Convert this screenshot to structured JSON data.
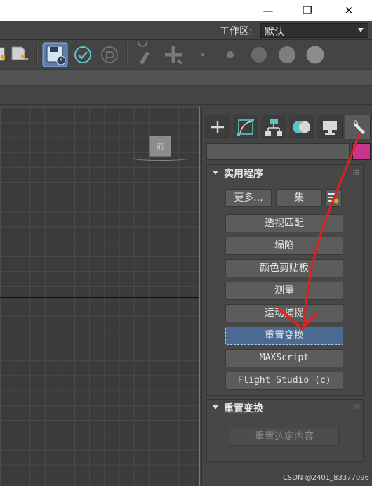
{
  "window": {
    "minimize_glyph": "—",
    "maximize_glyph": "❐",
    "close_glyph": "✕"
  },
  "workspace": {
    "label": "工作区:",
    "selected": "默认"
  },
  "toolbar": {
    "icons": [
      "rename-objects-icon",
      "scene-explorer-icon",
      "autosave-icon",
      "accept-icon",
      "undo-history-icon",
      "paint-brush-icon",
      "move-plus-icon",
      "brush-size-1-icon",
      "brush-size-2-icon",
      "brush-size-3-icon",
      "brush-size-4-icon",
      "brush-size-5-icon"
    ]
  },
  "viewport": {
    "viewcube_label": "前"
  },
  "command_panel": {
    "tabs": [
      "create-tab",
      "modify-tab",
      "hierarchy-tab",
      "motion-tab",
      "display-tab",
      "utilities-tab"
    ],
    "active_tab": "utilities-tab",
    "name_value": "",
    "swatch_color": "#c8348e",
    "utilities": {
      "title": "实用程序",
      "more_label": "更多...",
      "sets_label": "集",
      "buttons": [
        "透视匹配",
        "塌陷",
        "颜色剪贴板",
        "测量",
        "运动捕捉",
        "重置变换",
        "MAXScript",
        "Flight Studio (c)"
      ],
      "selected_button": "重置变换"
    },
    "reset_xform": {
      "title": "重置变换",
      "reset_selected_label": "重置选定内容"
    }
  },
  "annotation": {
    "arrow_color": "#e02020"
  },
  "watermark": "CSDN @2401_83377096"
}
